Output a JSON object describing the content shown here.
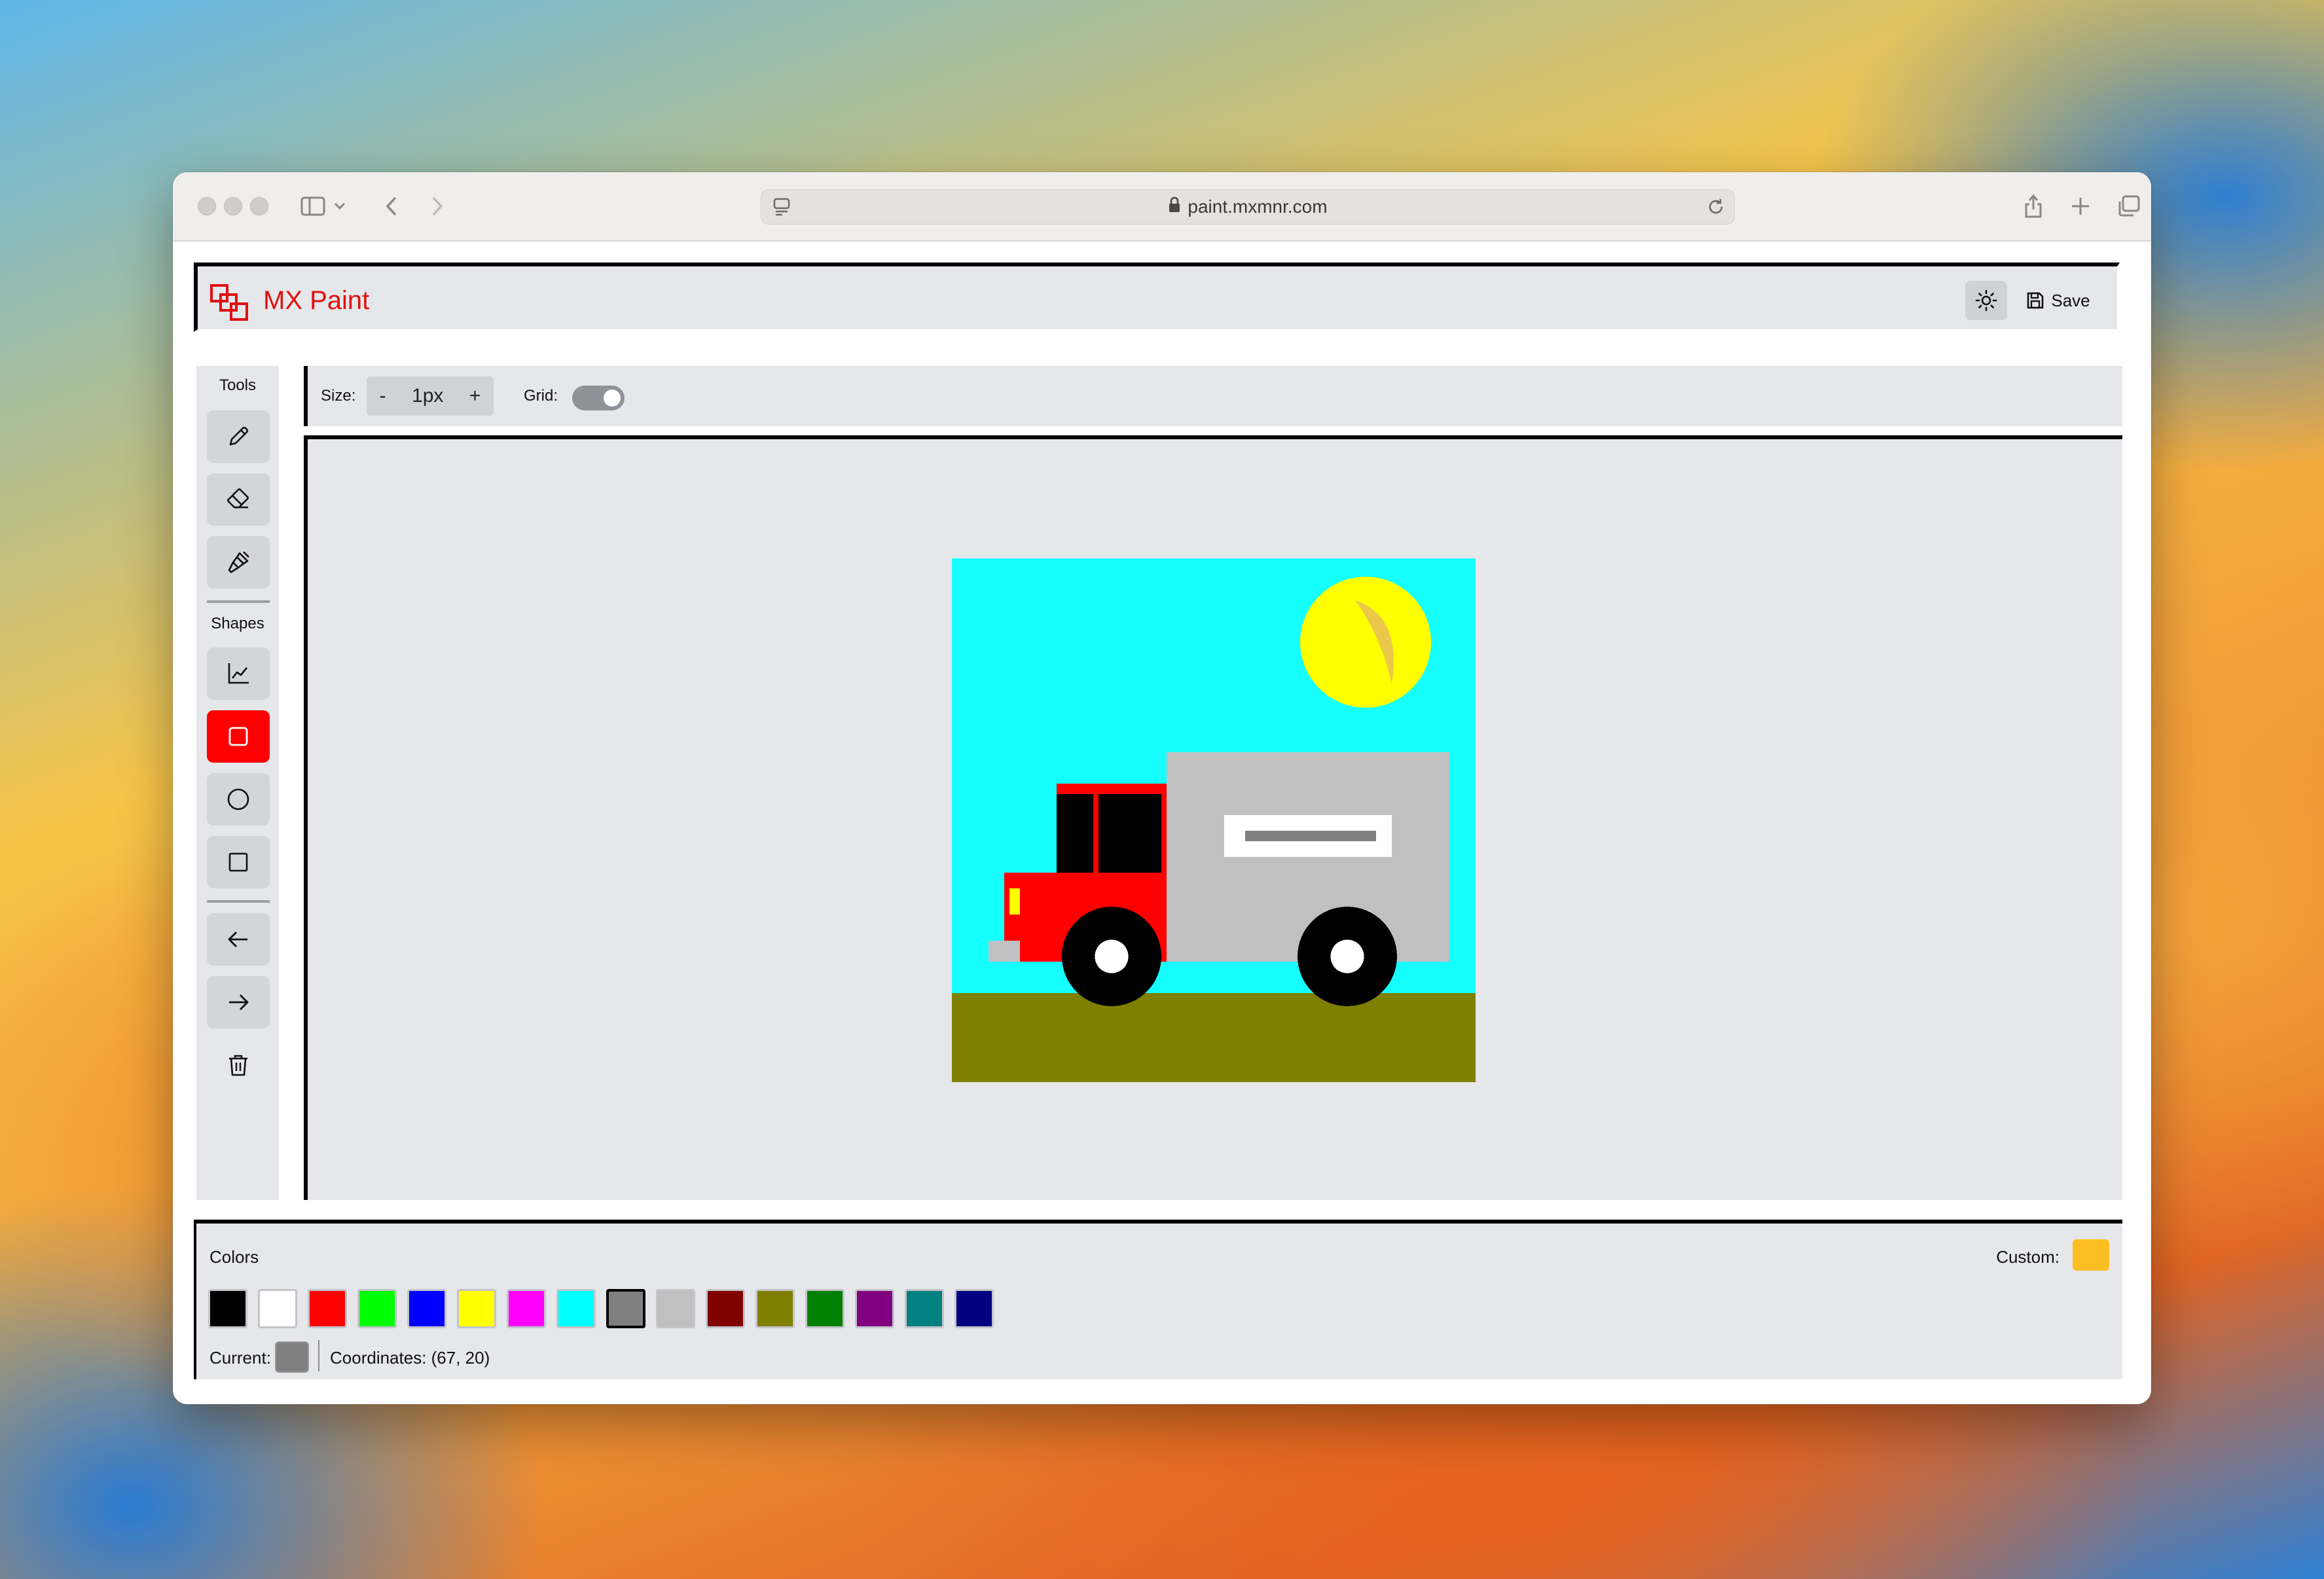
{
  "browser": {
    "url": "paint.mxmnr.com"
  },
  "app": {
    "title": "MX Paint",
    "save_label": "Save"
  },
  "toolbar": {
    "tools_label": "Tools",
    "shapes_label": "Shapes",
    "tools": [
      {
        "name": "pencil-icon"
      },
      {
        "name": "eraser-icon"
      },
      {
        "name": "paint-brush-icon"
      }
    ],
    "shapes": [
      {
        "name": "line-chart-icon"
      },
      {
        "name": "rectangle-icon",
        "active": true
      },
      {
        "name": "circle-icon"
      },
      {
        "name": "square-icon"
      }
    ],
    "actions": [
      {
        "name": "undo-arrow-icon"
      },
      {
        "name": "redo-arrow-icon"
      },
      {
        "name": "trash-icon"
      }
    ]
  },
  "options": {
    "size_label": "Size:",
    "size_minus": "-",
    "size_value": "1px",
    "size_plus": "+",
    "grid_label": "Grid:",
    "grid_on": true
  },
  "palette": {
    "colors_label": "Colors",
    "custom_label": "Custom:",
    "custom_color": "#fbbf24",
    "colors": [
      "#000000",
      "#ffffff",
      "#ff0000",
      "#00ff00",
      "#0000ff",
      "#ffff00",
      "#ff00ff",
      "#00ffff",
      "#808080",
      "#c0c0c0",
      "#800000",
      "#808000",
      "#008000",
      "#800080",
      "#008080",
      "#000080"
    ],
    "selected_index": 8,
    "current_label": "Current:",
    "current_color": "#808080",
    "coordinates": "Coordinates: (67, 20)"
  },
  "drawing": {
    "sky": "#15ffff",
    "ground": "#808000",
    "sun": "#ffff00",
    "sun_shade": "#ecc84a",
    "cab": "#ff0000",
    "windows": "#000000",
    "body": "#c0c0c0",
    "sign": "#ffffff",
    "sign_stripe": "#808080",
    "tire": "#000000",
    "hub": "#ffffff",
    "headlight": "#ffff00",
    "bumper": "#c0c0c0"
  }
}
